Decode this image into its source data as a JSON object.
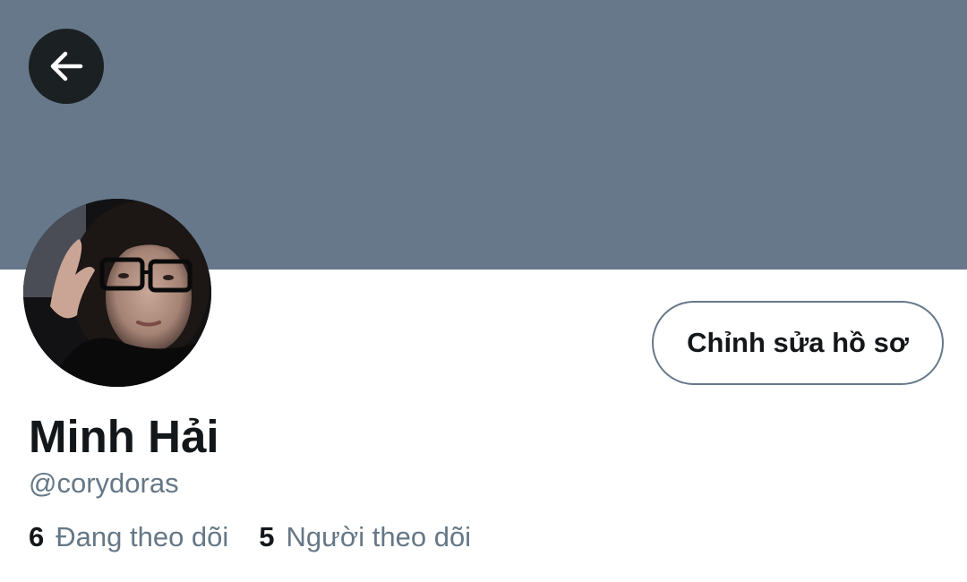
{
  "header": {
    "back_icon": "arrow-left-icon",
    "banner_color": "#66788a"
  },
  "profile": {
    "avatar_icon": "profile-photo",
    "edit_button_label": "Chỉnh sửa hồ sơ",
    "display_name": "Minh Hải",
    "handle": "@corydoras",
    "following_count": "6",
    "following_label": "Đang theo dõi",
    "followers_count": "5",
    "followers_label": "Người theo dõi"
  },
  "colors": {
    "text_primary": "#14171a",
    "text_secondary": "#657786",
    "back_button_bg": "#1b2023"
  }
}
